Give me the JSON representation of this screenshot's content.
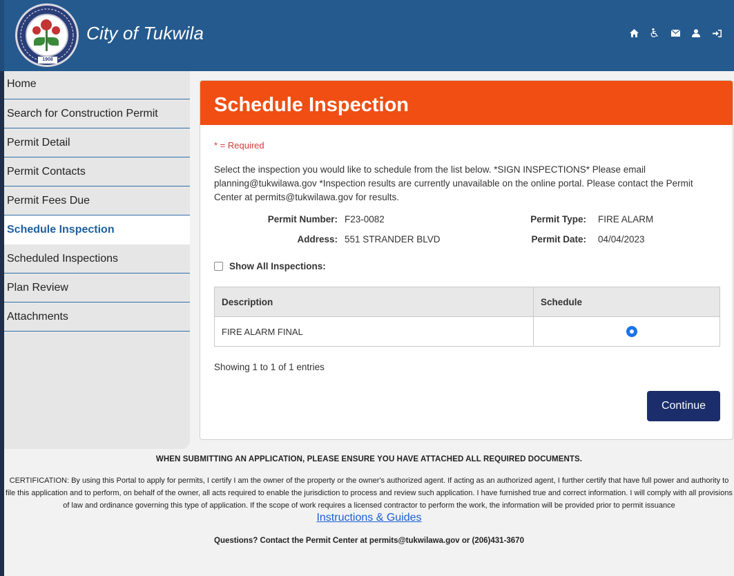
{
  "header": {
    "title": "City of Tukwila",
    "seal_year": "1908",
    "icons": [
      "home-icon",
      "accessibility-icon",
      "mail-icon",
      "user-icon",
      "sign-out-icon"
    ]
  },
  "sidebar": {
    "items": [
      {
        "label": "Home",
        "active": false
      },
      {
        "label": "Search for Construction Permit",
        "active": false
      },
      {
        "label": "Permit Detail",
        "active": false
      },
      {
        "label": "Permit Contacts",
        "active": false
      },
      {
        "label": "Permit Fees Due",
        "active": false
      },
      {
        "label": "Schedule Inspection",
        "active": true
      },
      {
        "label": "Scheduled Inspections",
        "active": false
      },
      {
        "label": "Plan Review",
        "active": false
      },
      {
        "label": "Attachments",
        "active": false
      }
    ]
  },
  "main": {
    "title": "Schedule Inspection",
    "required_note": "* = Required",
    "instructions": "Select the inspection you would like to schedule from the list below. *SIGN INSPECTIONS* Please email planning@tukwilawa.gov *Inspection results are currently unavailable on the online portal. Please contact the Permit Center at permits@tukwilawa.gov for results.",
    "permit": {
      "number_label": "Permit Number:",
      "number": "F23-0082",
      "type_label": "Permit Type:",
      "type": "FIRE ALARM",
      "address_label": "Address:",
      "address": "551 STRANDER BLVD",
      "date_label": "Permit Date:",
      "date": "04/04/2023"
    },
    "show_all_label": "Show All Inspections:",
    "show_all_checked": false,
    "table": {
      "headers": [
        "Description",
        "Schedule"
      ],
      "rows": [
        {
          "description": "FIRE ALARM FINAL",
          "selected": true
        }
      ]
    },
    "showing_text": "Showing 1 to 1 of 1 entries",
    "continue_label": "Continue"
  },
  "footer": {
    "notice": "WHEN SUBMITTING AN APPLICATION, PLEASE ENSURE YOU HAVE ATTACHED ALL REQUIRED DOCUMENTS.",
    "certification": "CERTIFICATION: By using this Portal to apply for permits, I certify I am the owner of the property or the owner's authorized agent. If acting as an authorized agent, I further certify that have full power and authority to file this application and to perform, on behalf of the owner, all acts required to enable the jurisdiction to process and review such application. I have furnished true and correct information. I will comply with all provisions of law and ordinance governing this type of application. If the scope of work requires a licensed contractor to perform the work, the information will be provided prior to permit issuance",
    "instructions_link": "Instructions & Guides",
    "questions": "Questions? Contact the Permit Center at permits@tukwilawa.gov or (206)431-3670"
  },
  "colors": {
    "header_blue": "#255a8e",
    "title_orange": "#f04e12",
    "button_navy": "#1b2e6b",
    "active_nav": "#1d5fa0",
    "radio_blue": "#1a73e8"
  }
}
